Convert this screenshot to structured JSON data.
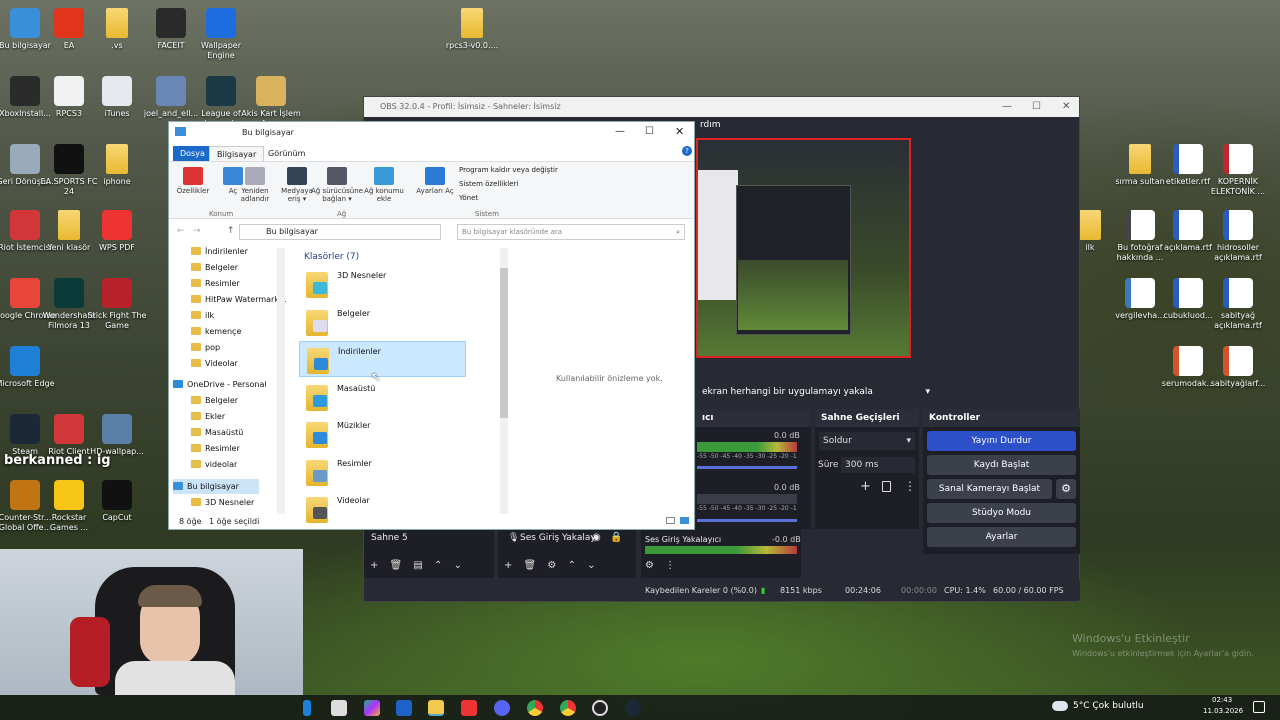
{
  "desktop": {
    "icons": [
      {
        "label": "Bu bilgisayar",
        "color": "#3a8fd9"
      },
      {
        "label": "EA",
        "color": "#e0351b"
      },
      {
        "label": ".vs",
        "color": ""
      },
      {
        "label": "FACEIT",
        "color": "#2a2a2a"
      },
      {
        "label": "Wallpaper Engine",
        "color": "#1d6de0"
      },
      {
        "label": "rpcs3-v0.0....",
        "color": ""
      },
      {
        "label": "XboxInstall...",
        "color": "#2b2b2b"
      },
      {
        "label": "RPCS3",
        "color": "#f2f2f2"
      },
      {
        "label": "iTunes",
        "color": "#e8e8ef"
      },
      {
        "label": "joel_and_ell...",
        "color": "#6a86b7"
      },
      {
        "label": "League of Legends",
        "color": "#1c3a45"
      },
      {
        "label": "Akis Kart İşlem Arası",
        "color": "#d8b25c"
      },
      {
        "label": "Geri Dönüşü...",
        "color": "#9ab"
      },
      {
        "label": "EA SPORTS FC 24",
        "color": "#111"
      },
      {
        "label": "iphone",
        "color": ""
      },
      {
        "label": "Riot İstemcisi",
        "color": "#d13639"
      },
      {
        "label": "Yeni klasör",
        "color": ""
      },
      {
        "label": "WPS PDF",
        "color": "#e33"
      },
      {
        "label": "Google Chrome",
        "color": "#e8463a"
      },
      {
        "label": "Wondershare Filmora 13",
        "color": "#0a3b3a"
      },
      {
        "label": "Stick Fight The Game",
        "color": "#b8202a"
      },
      {
        "label": "Microsoft Edge",
        "color": "#1d7fd6"
      },
      {
        "label": "Steam",
        "color": "#1b2838"
      },
      {
        "label": "Riot Client",
        "color": "#d13639"
      },
      {
        "label": "HD-wallpap...",
        "color": "#5a7fa8"
      },
      {
        "label": "Counter-Str... Global Offe...",
        "color": "#c07414"
      },
      {
        "label": "Rockstar Games ...",
        "color": "#f5c518"
      },
      {
        "label": "CapCut",
        "color": "#111"
      }
    ],
    "right_icons": [
      {
        "label": "sırma sultan",
        "color": ""
      },
      {
        "label": "etiketler.rtf",
        "color": "#2a5bbf"
      },
      {
        "label": "KOPERNİK ELEKTONİK ...",
        "color": "#c0262b"
      },
      {
        "label": "ilk",
        "color": ""
      },
      {
        "label": "Bu fotoğraf hakkında ...",
        "color": "#444"
      },
      {
        "label": "açıklama.rtf",
        "color": "#2a5bbf"
      },
      {
        "label": "hidrosoller açıklama.rtf",
        "color": "#2a5bbf"
      },
      {
        "label": "vergilevha...",
        "color": "#3a7ab8"
      },
      {
        "label": "cubukluod...",
        "color": "#2a5bbf"
      },
      {
        "label": "sabityağ açıklama.rtf",
        "color": "#2a5bbf"
      },
      {
        "label": "serumodak...",
        "color": "#d3542b"
      },
      {
        "label": "sabityağlarf...",
        "color": "#d3542b"
      }
    ],
    "overlay_text": "berkanned : ig",
    "activation_text": "Windows'u Etkinleştir",
    "activation_sub": "Windows'u etkinleştirmek için Ayarlar'a gidin."
  },
  "obs": {
    "title": "OBS 32.0.4 - Profil: İsimsiz - Sahneler: İsimsiz",
    "preview_label": "rdım",
    "capture_select": "ekran herhangi bir uygulamayı yakala",
    "mixer_title": "ıcı",
    "mixer_tracks": [
      {
        "db": "0.0 dB"
      },
      {
        "db": "0.0 dB"
      }
    ],
    "meter_scale": "-55 -50 -45 -40 -35 -30 -25 -20 -15 -10 -5 0",
    "transitions_title": "Sahne Geçişleri",
    "transition_value": "Soldur",
    "duration_label": "Süre",
    "duration_value": "300 ms",
    "controls_title": "Kontroller",
    "controls": [
      "Yayını Durdur",
      "Kaydı Başlat",
      "Sanal Kamerayı Başlat",
      "Stüdyo Modu",
      "Ayarlar"
    ],
    "scene": "Sahne 5",
    "source": "Ses Giriş Yakalayı",
    "audio_track": "Ses Giriş Yakalayıcı",
    "audio_db": "-0.0 dB",
    "status": {
      "dropped": "Kaybedilen Kareler 0 (%0.0)",
      "bitrate": "8151 kbps",
      "live": "00:24:06",
      "rec": "00:00:00",
      "cpu": "CPU: 1.4%",
      "fps": "60.00 / 60.00 FPS"
    }
  },
  "explorer": {
    "title": "Bu bilgisayar",
    "tabs": [
      "Dosya",
      "Bilgisayar",
      "Görünüm"
    ],
    "ribbon": {
      "buttons": [
        {
          "label": "Özellikler",
          "color": "#d33"
        },
        {
          "label": "Aç",
          "color": "#3a87d8"
        },
        {
          "label": "Yeniden adlandır",
          "color": "#aab"
        },
        {
          "label": "Medyaya eriş ▾",
          "color": "#345"
        },
        {
          "label": "Ağ sürücüsüne bağlan ▾",
          "color": "#556"
        },
        {
          "label": "Ağ konumu ekle",
          "color": "#3a9ad8"
        },
        {
          "label": "Ayarları Aç",
          "color": "#2a7ad8"
        }
      ],
      "links": [
        "Program kaldır veya değiştir",
        "Sistem özellikleri",
        "Yönet"
      ],
      "groups": [
        "Konum",
        "Ağ",
        "Sistem"
      ]
    },
    "address": "Bu bilgisayar",
    "search_placeholder": "Bu bilgisayar klasöründe ara",
    "nav": [
      "İndirilenler",
      "Belgeler",
      "Resimler",
      "HitPaw Watermark...",
      "ilk",
      "kemençe",
      "pop",
      "Videolar",
      "OneDrive - Personal",
      "Belgeler",
      "Ekler",
      "Masaüstü",
      "Resimler",
      "videolar",
      "Bu bilgisayar",
      "3D Nesneler"
    ],
    "section": "Klasörler (7)",
    "folders": [
      {
        "name": "3D Nesneler",
        "color": "#3ab8d8"
      },
      {
        "name": "Belgeler",
        "color": "#dde"
      },
      {
        "name": "İndirilenler",
        "color": "#2d89d9"
      },
      {
        "name": "Masaüstü",
        "color": "#2f9ae0"
      },
      {
        "name": "Müzikler",
        "color": "#2d89d9"
      },
      {
        "name": "Resimler",
        "color": "#6a9ac8"
      },
      {
        "name": "Videolar",
        "color": "#555"
      }
    ],
    "preview_empty": "Kullanılabilir önizleme yok.",
    "status_count": "8 öğe",
    "status_selected": "1 öğe seçildi"
  },
  "taskbar": {
    "weather": "5°C  Çok bulutlu",
    "time": "02:43",
    "date": "11.03.2026"
  }
}
